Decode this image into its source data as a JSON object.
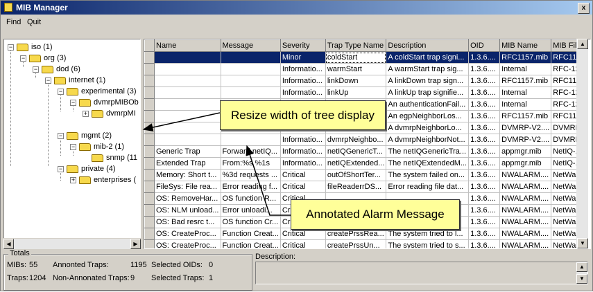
{
  "window": {
    "title": "MIB Manager",
    "close_glyph": "x"
  },
  "menu": {
    "items": [
      "Find",
      "Quit"
    ]
  },
  "tree": {
    "nodes": [
      {
        "label": "iso (1)",
        "toggle": "−"
      },
      {
        "label": "org (3)",
        "toggle": "−"
      },
      {
        "label": "dod (6)",
        "toggle": "−"
      },
      {
        "label": "internet (1)",
        "toggle": "−"
      },
      {
        "label": "experimental (3)",
        "toggle": "−"
      },
      {
        "label": "dvmrpMIBOb",
        "toggle": "−"
      },
      {
        "label": "dvmrpMI",
        "toggle": "+"
      },
      {
        "label": "mgmt (2)",
        "toggle": "−"
      },
      {
        "label": "mib-2 (1)",
        "toggle": "−"
      },
      {
        "label": "snmp (11",
        "toggle": ""
      },
      {
        "label": "private (4)",
        "toggle": "−"
      },
      {
        "label": "enterprises (",
        "toggle": "+"
      }
    ]
  },
  "table": {
    "columns": [
      "Name",
      "Message",
      "Severity",
      "Trap Type Name",
      "Description",
      "OID",
      "MIB Name",
      "MIB File"
    ],
    "rows": [
      [
        "",
        "",
        "Minor",
        "coldStart",
        "A coldStart trap signi...",
        "1.3.6....",
        "RFC1157.mib",
        "RFC11..."
      ],
      [
        "",
        "",
        "Informatio...",
        "warmStart",
        "A warmStart trap sig...",
        "1.3.6....",
        "Internal",
        "RFC-12..."
      ],
      [
        "",
        "",
        "Informatio...",
        "linkDown",
        "A linkDown trap sign...",
        "1.3.6....",
        "RFC1157.mib",
        "RFC11..."
      ],
      [
        "",
        "",
        "Informatio...",
        "linkUp",
        "A linkUp trap signifie...",
        "1.3.6....",
        "Internal",
        "RFC-12..."
      ],
      [
        "",
        "",
        "",
        "",
        "An authenticationFail...",
        "1.3.6....",
        "Internal",
        "RFC-12..."
      ],
      [
        "",
        "",
        "",
        "",
        "An egpNeighborLos...",
        "1.3.6....",
        "RFC1157.mib",
        "RFC11..."
      ],
      [
        "",
        "",
        "",
        "",
        "A dvmrpNeighborLo...",
        "1.3.6....",
        "DVMRP-V2....",
        "DVMRP..."
      ],
      [
        "",
        "",
        "Informatio...",
        "dvmrpNeighbo...",
        "A dvmrpNeighborNot...",
        "1.3.6....",
        "DVMRP-V2....",
        "DVMRP..."
      ],
      [
        "Generic Trap",
        "Forward netIQ...",
        "Informatio...",
        "netIQGenericT...",
        "The netIQGenericTra...",
        "1.3.6....",
        "appmgr.mib",
        "NetIQ-..."
      ],
      [
        "Extended Trap",
        "From:%s %1s",
        "Informatio...",
        "netIQExtended...",
        "The netIQExtendedM...",
        "1.3.6....",
        "appmgr.mib",
        "NetIQ-..."
      ],
      [
        "Memory: Short t...",
        "%3d requests ...",
        "Critical",
        "outOfShortTer...",
        "The system failed on...",
        "1.3.6....",
        "NWALARM....",
        "NetWar..."
      ],
      [
        "FileSys: File rea...",
        "Error reading f...",
        "Critical",
        "fileReaderrDS...",
        "Error reading file dat...",
        "1.3.6....",
        "NWALARM....",
        "NetWar..."
      ],
      [
        "OS: RemoveHar...",
        "OS function R...",
        "Critical",
        "",
        "",
        "1.3.6....",
        "NWALARM....",
        "NetWar..."
      ],
      [
        "OS: NLM unload...",
        "Error unloadi...",
        "Critical",
        "",
        "",
        "1.3.6....",
        "NWALARM....",
        "NetWar..."
      ],
      [
        "OS: Bad resrc t...",
        "OS function Cr...",
        "Critical",
        "",
        "",
        "1.3.6....",
        "NWALARM....",
        "NetWar..."
      ],
      [
        "OS: CreateProc...",
        "Function Creat...",
        "Critical",
        "createPrssRea...",
        "The system tried to l...",
        "1.3.6....",
        "NWALARM....",
        "NetWar..."
      ],
      [
        "OS: CreateProc...",
        "Function Creat...",
        "Critical",
        "createPrssUn...",
        "The system tried to s...",
        "1.3.6....",
        "NWALARM....",
        "NetWar..."
      ]
    ]
  },
  "totals": {
    "legend": "Totals",
    "mibs_label": "MIBs:",
    "mibs_value": "55",
    "annoted_label": "Annonted Traps:",
    "annoted_value": "1195",
    "selected_oids_label": "Selected OIDs:",
    "selected_oids_value": "0",
    "traps_label": "Traps:",
    "traps_value": "1204",
    "nonannoted_label": "Non-Annonated Traps:",
    "nonannoted_value": "9",
    "selected_traps_label": "Selected Traps:",
    "selected_traps_value": "1"
  },
  "description": {
    "label": "Description:"
  },
  "callouts": {
    "resize": "Resize width of tree display",
    "annotated": "Annotated Alarm Message"
  },
  "colors": {
    "selection": "#0a246a",
    "callout": "#ffff99",
    "folder": "#f7d94c"
  }
}
